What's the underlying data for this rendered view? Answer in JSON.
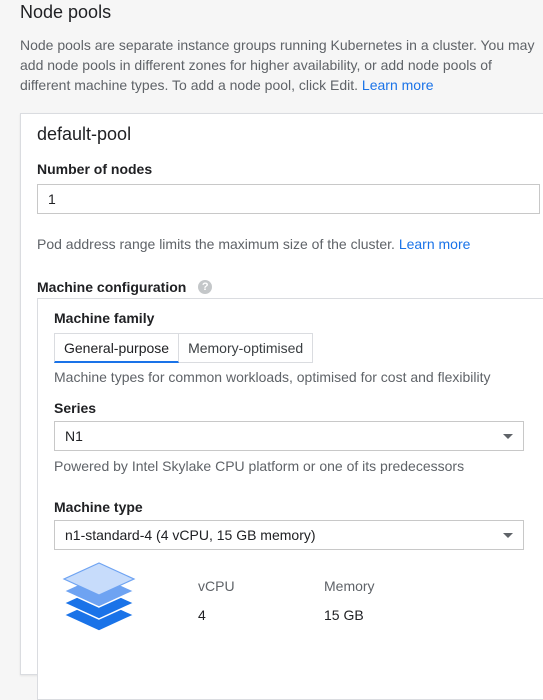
{
  "section": {
    "title": "Node pools",
    "description": "Node pools are separate instance groups running Kubernetes in a cluster. You may add node pools in different zones for higher availability, or add node pools of different machine types. To add a node pool, click Edit.",
    "learn_more": "Learn more"
  },
  "pool": {
    "name": "default-pool",
    "nodes_label": "Number of nodes",
    "nodes_value": "1",
    "pod_range_text": "Pod address range limits the maximum size of the cluster.",
    "pod_range_link": "Learn more",
    "machine_config_label": "Machine configuration",
    "help_glyph": "?"
  },
  "machine": {
    "family_label": "Machine family",
    "tabs": [
      {
        "label": "General-purpose",
        "active": true
      },
      {
        "label": "Memory-optimised",
        "active": false
      }
    ],
    "family_help": "Machine types for common workloads, optimised for cost and flexibility",
    "series_label": "Series",
    "series_value": "N1",
    "series_help": "Powered by Intel Skylake CPU platform or one of its predecessors",
    "type_label": "Machine type",
    "type_value": "n1-standard-4 (4 vCPU, 15 GB memory)",
    "vcpu_label": "vCPU",
    "vcpu_value": "4",
    "memory_label": "Memory",
    "memory_value": "15 GB"
  },
  "colors": {
    "link": "#1a73e8",
    "stack_light": "#c7dcfb",
    "stack_mid": "#6ea3f2",
    "stack_dark": "#1a73e8"
  },
  "icons": {
    "help": "help-circle-icon",
    "dropdown": "triangle-down-icon",
    "machine": "layers-stack-icon"
  }
}
